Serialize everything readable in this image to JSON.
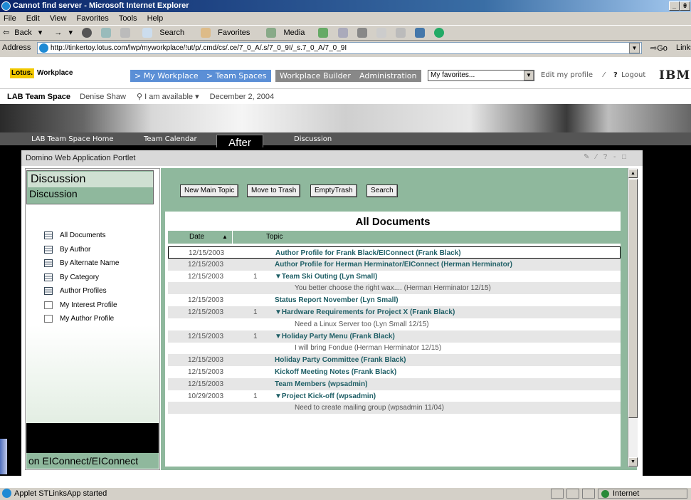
{
  "window": {
    "title": "Cannot find server - Microsoft Internet Explorer",
    "buttons": [
      "_",
      "θ"
    ]
  },
  "menu": [
    "File",
    "Edit",
    "View",
    "Favorites",
    "Tools",
    "Help"
  ],
  "toolbar": {
    "back": "Back",
    "forward": "→",
    "search": "Search",
    "favorites": "Favorites",
    "media": "Media"
  },
  "address": {
    "label": "Address",
    "url": "http://tinkertoy.lotus.com/lwp/myworkplace/!ut/p/.cmd/cs/.ce/7_0_A/.s/7_0_9I/_s.7_0_A/7_0_9I",
    "go": "Go",
    "links": "Links"
  },
  "lotus": {
    "logo": "Lotus.",
    "product": "Workplace",
    "nav": [
      "> My Workplace",
      "> Team Spaces",
      "Workplace Builder",
      "Administration"
    ],
    "favorites": "My favorites...",
    "edit_profile": "Edit my profile",
    "help": "?",
    "logout": "Logout",
    "ibm": "IBM."
  },
  "teambar": {
    "space": "LAB Team Space",
    "user": "Denise Shaw",
    "status": "I am available ▾",
    "date": "December 2, 2004"
  },
  "tabs": {
    "home": "LAB Team Space Home",
    "calendar": "Team Calendar",
    "after": "After",
    "discussion": "Discussion"
  },
  "portlet": {
    "title": "Domino Web Application Portlet",
    "controls": "✎ ⁄ ? - □",
    "left": {
      "heading": "Discussion",
      "subheading": "Discussion",
      "items": [
        "All Documents",
        "By Author",
        "By Alternate Name",
        "By Category",
        "Author Profiles",
        "My Interest Profile",
        "My Author Profile"
      ],
      "footer": "on EIConnect/EIConnect"
    },
    "buttons": [
      "New Main Topic",
      "Move to Trash",
      "EmptyTrash",
      "Search"
    ],
    "view_title": "All Documents",
    "columns": {
      "date": "Date",
      "sort": "▲",
      "topic": "Topic"
    },
    "rows": [
      {
        "date": "12/15/2003",
        "count": "",
        "topic": "Author Profile for Frank Black/EIConnect (Frank Black)",
        "type": "doc"
      },
      {
        "date": "12/15/2003",
        "count": "",
        "topic": "Author Profile for Herman Herminator/EIConnect (Herman Herminator)",
        "type": "doc"
      },
      {
        "date": "12/15/2003",
        "count": "1",
        "topic": "▼Team Ski Outing (Lyn Small)",
        "type": "doc"
      },
      {
        "date": "",
        "count": "",
        "topic": "You better choose the right wax.... (Herman Herminator 12/15)",
        "type": "resp"
      },
      {
        "date": "12/15/2003",
        "count": "",
        "topic": "Status Report November (Lyn Small)",
        "type": "doc"
      },
      {
        "date": "12/15/2003",
        "count": "1",
        "topic": "▼Hardware Requirements for Project X (Frank Black)",
        "type": "doc"
      },
      {
        "date": "",
        "count": "",
        "topic": "Need a Linux Server too  (Lyn Small 12/15)",
        "type": "resp"
      },
      {
        "date": "12/15/2003",
        "count": "1",
        "topic": "▼Holiday Party Menu (Frank Black)",
        "type": "doc"
      },
      {
        "date": "",
        "count": "",
        "topic": "I will bring Fondue  (Herman Herminator 12/15)",
        "type": "resp"
      },
      {
        "date": "12/15/2003",
        "count": "",
        "topic": "Holiday Party Committee (Frank Black)",
        "type": "doc"
      },
      {
        "date": "12/15/2003",
        "count": "",
        "topic": "Kickoff Meeting Notes (Frank Black)",
        "type": "doc"
      },
      {
        "date": "12/15/2003",
        "count": "",
        "topic": "Team Members (wpsadmin)",
        "type": "doc"
      },
      {
        "date": "10/29/2003",
        "count": "1",
        "topic": "▼Project Kick-off (wpsadmin)",
        "type": "doc"
      },
      {
        "date": "",
        "count": "",
        "topic": "Need to create mailing group  (wpsadmin 11/04)",
        "type": "resp"
      }
    ]
  },
  "statusbar": {
    "text": "Applet STLinksApp started",
    "zone": "Internet"
  }
}
